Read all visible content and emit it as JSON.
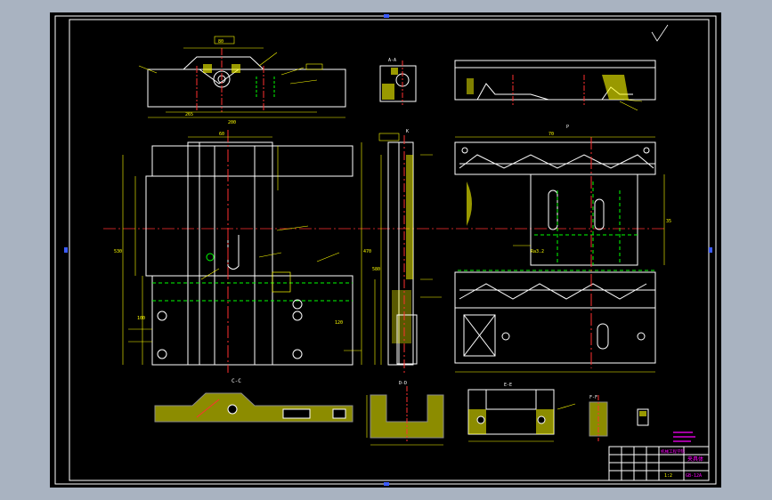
{
  "colors": {
    "frame": "#ffffff",
    "outline": "#ffffff",
    "dimension": "#ffff00",
    "centerline": "#ff3030",
    "hidden": "#00ff00",
    "hatch": "#ffff00",
    "annotation": "#ff00ff",
    "grip": "#3b5bff"
  },
  "labels": {
    "section_aa": "A-A",
    "section_bb": "B-B",
    "section_cc": "C-C",
    "section_dd": "D-D",
    "section_ee": "E-E",
    "section_ff": "F-F",
    "view_k": "K",
    "view_p": "P",
    "dim_200": "200",
    "dim_265": "265",
    "dim_530": "530",
    "dim_580": "580",
    "dim_470": "470",
    "dim_80": "80",
    "dim_60": "60",
    "dim_70": "70",
    "dim_100": "100",
    "dim_120": "120",
    "dim_35": "35",
    "roughness": "Ra3.2"
  },
  "title_block": {
    "drawing_name": "夹具体",
    "part_number": "GB-12A",
    "scale": "1:2",
    "school": "机械工程学院"
  }
}
